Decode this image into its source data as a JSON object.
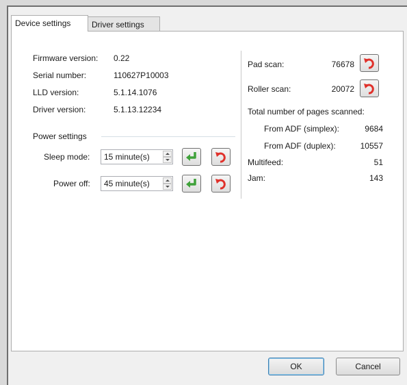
{
  "tabs": [
    {
      "label": "Device settings",
      "active": true
    },
    {
      "label": "Driver settings",
      "active": false
    }
  ],
  "device_info": {
    "firmware_label": "Firmware version:",
    "firmware_value": "0.22",
    "serial_label": "Serial number:",
    "serial_value": "110627P10003",
    "lld_label": "LLD version:",
    "lld_value": "5.1.14.1076",
    "driver_label": "Driver version:",
    "driver_value": "5.1.13.12234"
  },
  "power": {
    "group_label": "Power settings",
    "sleep_label": "Sleep mode:",
    "sleep_value": "15 minute(s)",
    "off_label": "Power off:",
    "off_value": "45 minute(s)"
  },
  "counters": {
    "pad_label": "Pad scan:",
    "pad_value": "76678",
    "roller_label": "Roller scan:",
    "roller_value": "20072",
    "total_label": "Total number of pages scanned:",
    "simplex_label": "From ADF (simplex):",
    "simplex_value": "9684",
    "duplex_label": "From ADF (duplex):",
    "duplex_value": "10557",
    "multifeed_label": "Multifeed:",
    "multifeed_value": "51",
    "jam_label": "Jam:",
    "jam_value": "143"
  },
  "footer": {
    "ok_label": "OK",
    "cancel_label": "Cancel"
  },
  "icons": {
    "apply": "apply-arrow-icon",
    "reset": "reset-undo-icon"
  },
  "colors": {
    "apply_green": "#3fa23a",
    "reset_red": "#e0312b",
    "panel_bg": "#ffffff",
    "dialog_bg": "#f0f0f0"
  }
}
